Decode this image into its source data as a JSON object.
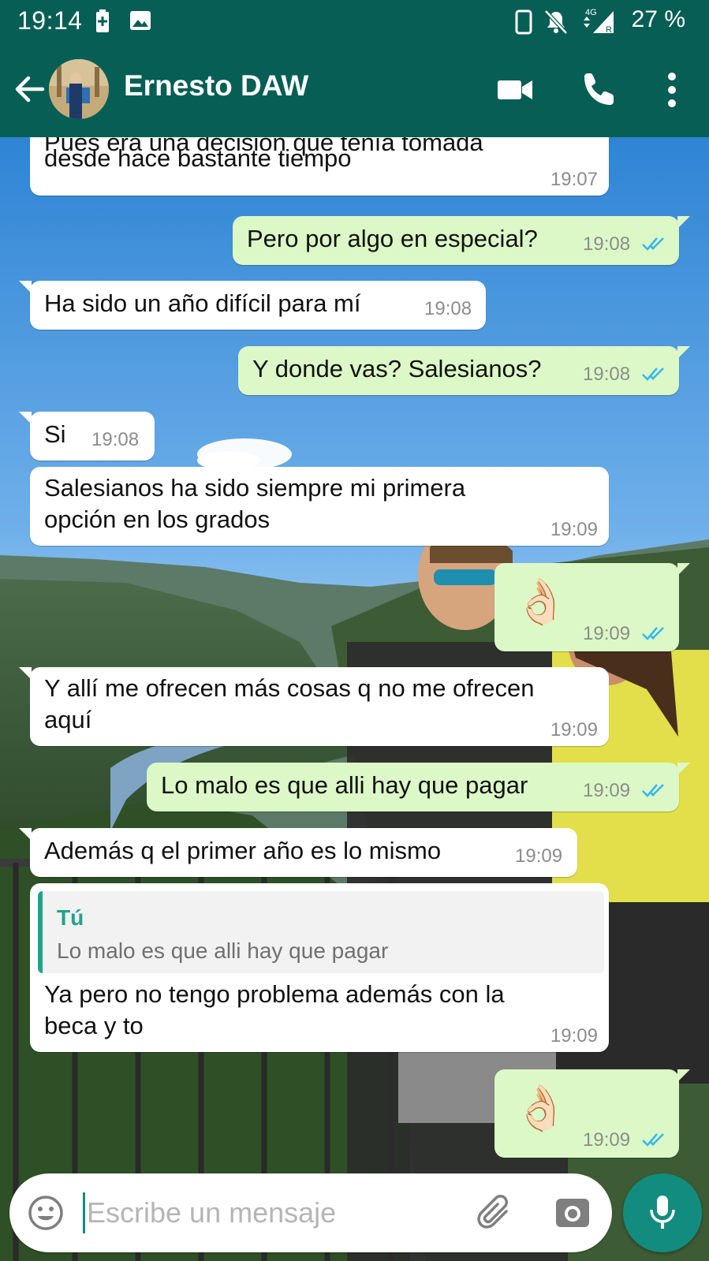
{
  "status_bar": {
    "time": "19:14",
    "battery_percent": "27 %",
    "network": "4G",
    "icons": [
      "battery-saver-icon",
      "gallery-notification-icon",
      "vibrate-icon",
      "notifications-off-icon",
      "signal-icon"
    ]
  },
  "header": {
    "contact_name": "Ernesto DAW",
    "buttons": [
      "back-arrow-icon",
      "video-call-icon",
      "phone-call-icon",
      "more-options-icon"
    ]
  },
  "colors": {
    "header_bg": "#075e54",
    "outgoing_bubble": "#dcf8c6",
    "incoming_bubble": "#ffffff",
    "read_ticks": "#34b7f1",
    "accent": "#128c7e",
    "quote_accent": "#1fa48c"
  },
  "messages": [
    {
      "dir": "in",
      "lines": [
        "Pues era una decisión que tenía tomada",
        "desde hace bastante tiempo"
      ],
      "time": "19:07"
    },
    {
      "dir": "out",
      "lines": [
        "Pero por algo en especial?"
      ],
      "time": "19:08",
      "read": true
    },
    {
      "dir": "in",
      "lines": [
        "Ha sido un año difícil para mí"
      ],
      "time": "19:08"
    },
    {
      "dir": "out",
      "lines": [
        "Y donde vas? Salesianos?"
      ],
      "time": "19:08",
      "read": true
    },
    {
      "dir": "in",
      "lines": [
        "Si"
      ],
      "time": "19:08"
    },
    {
      "dir": "in",
      "lines": [
        "Salesianos ha sido siempre mi primera",
        "opción en los grados"
      ],
      "time": "19:09"
    },
    {
      "dir": "out",
      "emoji": "👌🏻",
      "time": "19:09",
      "read": true
    },
    {
      "dir": "in",
      "lines": [
        "Y allí me ofrecen más cosas q no me ofrecen",
        "aquí"
      ],
      "time": "19:09"
    },
    {
      "dir": "out",
      "lines": [
        "Lo malo es que alli hay que pagar"
      ],
      "time": "19:09",
      "read": true
    },
    {
      "dir": "in",
      "lines": [
        "Además q el primer año es lo mismo"
      ],
      "time": "19:09"
    },
    {
      "dir": "in",
      "quote": {
        "author": "Tú",
        "text": "Lo malo es que alli hay que pagar"
      },
      "lines": [
        "Ya pero no tengo problema además con la",
        "beca y to"
      ],
      "time": "19:09"
    },
    {
      "dir": "out",
      "emoji": "👌🏻",
      "time": "19:09",
      "read": true
    }
  ],
  "input": {
    "placeholder": "Escribe un mensaje",
    "buttons": [
      "emoji-icon",
      "attach-icon",
      "camera-icon",
      "microphone-icon"
    ]
  }
}
